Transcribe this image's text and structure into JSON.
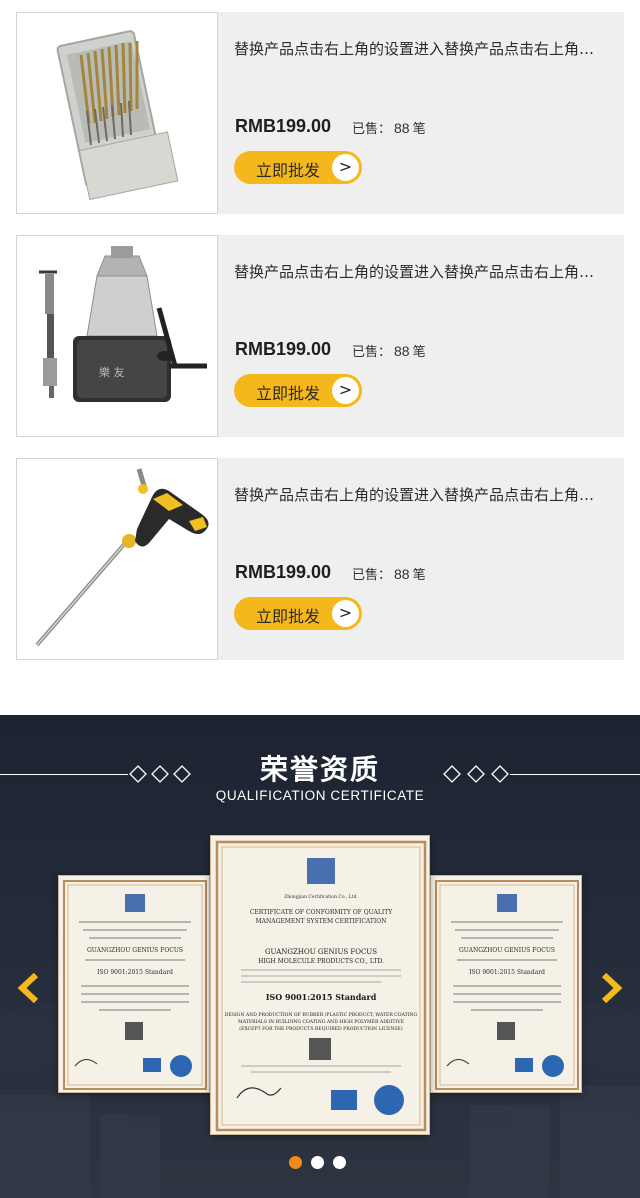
{
  "products": [
    {
      "title": "替换产品点击右上角的设置进入替换产品点击右上角的设置进入替换产品",
      "price": "RMB199.00",
      "sold_label": "已售：",
      "sold_count": "88",
      "sold_unit": "笔",
      "button_label": "立即批发",
      "button_icon": "chevron-right-icon",
      "image": "drill-bit-set-case"
    },
    {
      "title": "替换产品点击右上角的设置进入替换产品点击右上角的设置进入替换产品",
      "price": "RMB199.00",
      "sold_label": "已售：",
      "sold_count": "88",
      "sold_unit": "笔",
      "button_label": "立即批发",
      "button_icon": "chevron-right-icon",
      "image": "drill-chuck-with-key"
    },
    {
      "title": "替换产品点击右上角的设置进入替换产品点击右上角的设置进入替换产品",
      "price": "RMB199.00",
      "sold_label": "已售：",
      "sold_count": "88",
      "sold_unit": "笔",
      "button_label": "立即批发",
      "button_icon": "chevron-right-icon",
      "image": "t-handle-hex-key"
    }
  ],
  "certificates": {
    "title": "荣誉资质",
    "subtitle": "QUALIFICATION CERTIFICATE",
    "prev_icon": "chevron-left-icon",
    "next_icon": "chevron-right-icon",
    "slides_count": 3,
    "active_slide": 0,
    "certificate_text": {
      "issuer": "Zhongjian Certification Co., Ltd.",
      "heading_1": "CERTIFICATE OF CONFORMITY OF QUALITY",
      "heading_2": "MANAGEMENT SYSTEM CERTIFICATION",
      "company_1": "GUANGZHOU GENIUS FOCUS",
      "company_2": "HIGH MOLECULE PRODUCTS CO., LTD.",
      "standard": "ISO 9001:2015 Standard",
      "scope_1": "DESIGN AND PRODUCTION OF RUBBER /PLASTIC PRODUCT, WATER COATING",
      "scope_2": "MATERIALS IN BUILDING COATING AND HIGH POLYMER ADDITIVE",
      "scope_3": "(EXCEPT FOR THE PRODUCTS REQUIRED PRODUCTION LICENSE)"
    },
    "colors": {
      "accent": "#f5b81c",
      "dot_active": "#f08a1b",
      "section_bg": "#222938"
    }
  }
}
